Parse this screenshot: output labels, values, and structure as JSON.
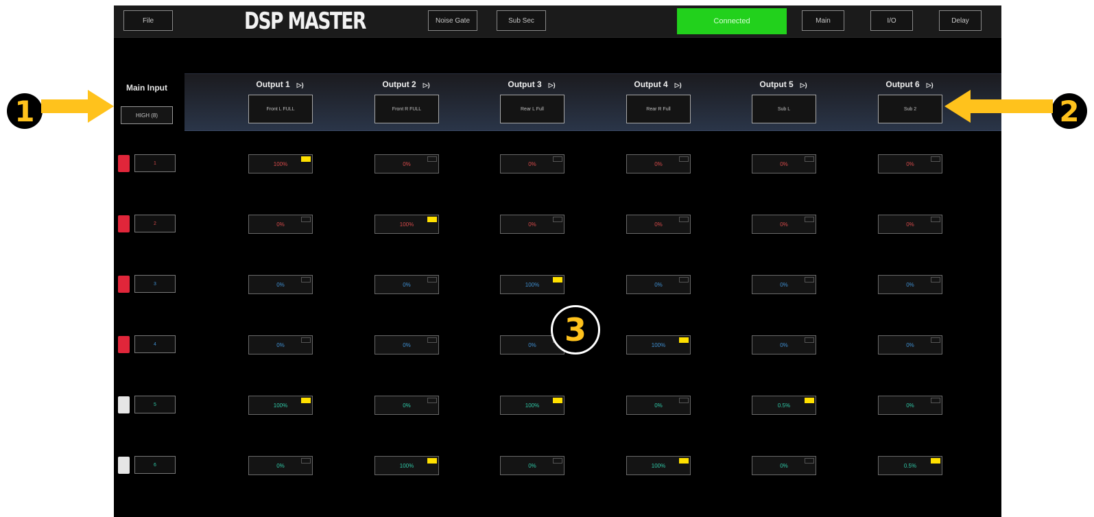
{
  "topbar": {
    "title": "DSP MASTER",
    "file_label": "File",
    "noise_gate_label": "Noise Gate",
    "sub_sec_label": "Sub Sec",
    "status_label": "Connected",
    "main_label": "Main",
    "io_label": "I/O",
    "delay_label": "Delay"
  },
  "main_input": {
    "label": "Main Input",
    "value": "HIGH (8)"
  },
  "outputs": [
    {
      "title": "Output 1",
      "assignment": "Front L FULL"
    },
    {
      "title": "Output 2",
      "assignment": "Front R FULL"
    },
    {
      "title": "Output 3",
      "assignment": "Rear L Full"
    },
    {
      "title": "Output 4",
      "assignment": "Rear R Full"
    },
    {
      "title": "Output 5",
      "assignment": "Sub L"
    },
    {
      "title": "Output 6",
      "assignment": "Sub 2"
    }
  ],
  "speaker_icon": "speaker-icon",
  "matrix": {
    "rows": [
      {
        "indicator_color": "#e0263a",
        "input_label": "1",
        "text_color": "#d64a4a",
        "cells": [
          {
            "value": "100%",
            "active": true
          },
          {
            "value": "0%",
            "active": false
          },
          {
            "value": "0%",
            "active": false
          },
          {
            "value": "0%",
            "active": false
          },
          {
            "value": "0%",
            "active": false
          },
          {
            "value": "0%",
            "active": false
          }
        ]
      },
      {
        "indicator_color": "#e0263a",
        "input_label": "2",
        "text_color": "#d64a4a",
        "cells": [
          {
            "value": "0%",
            "active": false
          },
          {
            "value": "100%",
            "active": true
          },
          {
            "value": "0%",
            "active": false
          },
          {
            "value": "0%",
            "active": false
          },
          {
            "value": "0%",
            "active": false
          },
          {
            "value": "0%",
            "active": false
          }
        ]
      },
      {
        "indicator_color": "#e0263a",
        "input_label": "3",
        "text_color": "#3f8fd1",
        "cells": [
          {
            "value": "0%",
            "active": false
          },
          {
            "value": "0%",
            "active": false
          },
          {
            "value": "100%",
            "active": true
          },
          {
            "value": "0%",
            "active": false
          },
          {
            "value": "0%",
            "active": false
          },
          {
            "value": "0%",
            "active": false
          }
        ]
      },
      {
        "indicator_color": "#e0263a",
        "input_label": "4",
        "text_color": "#3f8fd1",
        "cells": [
          {
            "value": "0%",
            "active": false
          },
          {
            "value": "0%",
            "active": false
          },
          {
            "value": "0%",
            "active": false
          },
          {
            "value": "100%",
            "active": true
          },
          {
            "value": "0%",
            "active": false
          },
          {
            "value": "0%",
            "active": false
          }
        ]
      },
      {
        "indicator_color": "#e6e6e6",
        "input_label": "5",
        "text_color": "#30c9a8",
        "cells": [
          {
            "value": "100%",
            "active": true
          },
          {
            "value": "0%",
            "active": false
          },
          {
            "value": "100%",
            "active": true
          },
          {
            "value": "0%",
            "active": false
          },
          {
            "value": "0.5%",
            "active": true
          },
          {
            "value": "0%",
            "active": false
          }
        ]
      },
      {
        "indicator_color": "#e6e6e6",
        "input_label": "6",
        "text_color": "#30c9a8",
        "cells": [
          {
            "value": "0%",
            "active": false
          },
          {
            "value": "100%",
            "active": true
          },
          {
            "value": "0%",
            "active": false
          },
          {
            "value": "100%",
            "active": true
          },
          {
            "value": "0%",
            "active": false
          },
          {
            "value": "0.5%",
            "active": true
          }
        ]
      }
    ]
  },
  "annotations": {
    "badge_1": "1",
    "badge_2": "2",
    "badge_3": "3",
    "accent_color": "#ffc21c"
  }
}
